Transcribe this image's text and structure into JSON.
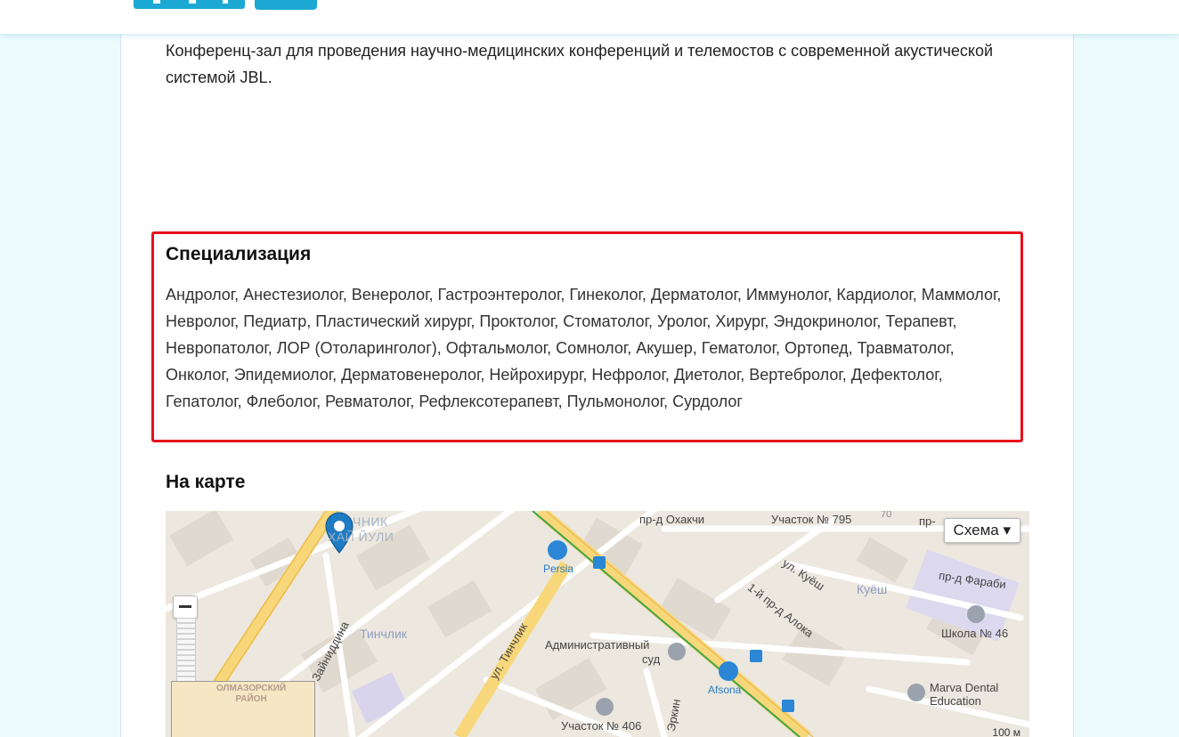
{
  "header": {
    "logo_alt": ""
  },
  "intro": {
    "text": "Конференц-зал для проведения научно-медицинских конференций и телемостов с современной акустической системой JBL."
  },
  "specialization": {
    "title": "Специализация",
    "text": "Андролог, Анестезиолог, Венеролог, Гастроэнтеролог, Гинеколог, Дерматолог, Иммунолог, Кардиолог, Маммолог, Невролог, Педиатр, Пластический хирург, Проктолог, Стоматолог, Уролог, Хирург, Эндокринолог, Терапевт, Невропатолог, ЛОР (Отоларинголог), Офтальмолог, Сомнолог, Акушер, Гематолог, Ортопед, Травматолог, Онколог, Эпидемиолог, Дерматовенеролог, Нейрохирург, Нефролог, Диетолог, Вертебролог, Дефектолог, Гепатолог, Флеболог, Ревматолог, Рефлексотерапевт, Пульмонолог, Сурдолог"
  },
  "map": {
    "title": "На карте",
    "type_button": "Схема ▾",
    "scale": "100 м",
    "labels": {
      "okhakchi": "пр-д Охакчи",
      "uchastok795": "Участок № 795",
      "n70": "70",
      "pr": "пр-",
      "district1": "ЧНИК",
      "district2": "ХАЙ ЙУЛИ",
      "persia": "Persia",
      "kuesh_st": "ул. Куёш",
      "kuesh": "Куёш",
      "farabi": "пр-д Фараби",
      "alloka": "1-й пр-д Алока",
      "tinchlik": "Тинчлик",
      "zainuddina": "Зайниддина",
      "tinchlik_st": "ул. Тинчлик",
      "court1": "Административный",
      "court2": "суд",
      "afsona": "Afsona",
      "school": "Школа № 46",
      "marva1": "Marva Dental",
      "marva2": "Education",
      "uchastok406": "Участок № 406",
      "erkin": "Эркин",
      "olmazor1": "ОЛМАЗОРСКИЙ",
      "olmazor2": "РАЙОН"
    }
  }
}
